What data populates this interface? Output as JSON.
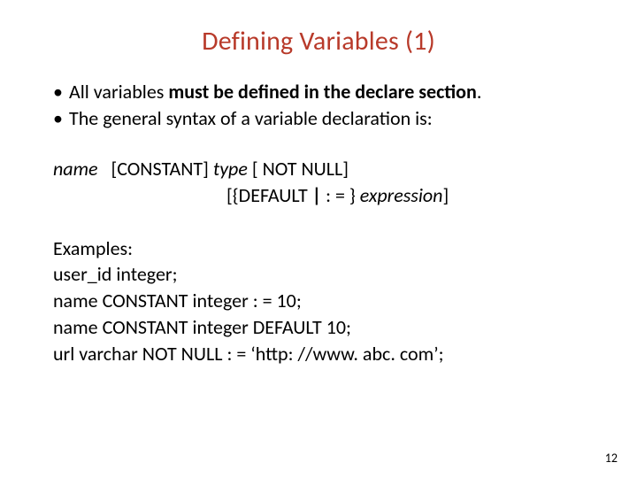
{
  "title": "Defining Variables (1)",
  "bullets": {
    "b1_pre": "All variables ",
    "b1_bold": "must be defined in the declare section",
    "b1_post": ".",
    "b2": "The general syntax of a variable declaration is:"
  },
  "syntax": {
    "l1_name": "name",
    "l1_const": "   [CONSTANT] ",
    "l1_type": "type",
    "l1_notnull": " [ NOT NULL]",
    "l2_pre": "[{DEFAULT ",
    "l2_bar": "|",
    "l2_assign": " : = } ",
    "l2_expr": "expression",
    "l2_post": "]"
  },
  "examples": {
    "heading": "Examples:",
    "e1": "user_id integer;",
    "e2": "name CONSTANT integer : = 10;",
    "e3": "name CONSTANT integer DEFAULT 10;",
    "e4": "url varchar NOT NULL : = ‘http: //www. abc. com’;"
  },
  "page_number": "12"
}
